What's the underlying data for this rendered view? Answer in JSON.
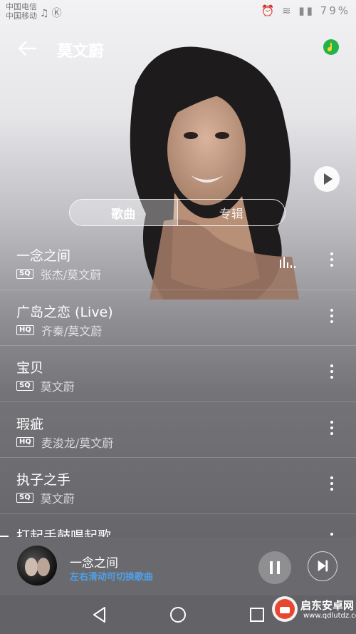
{
  "status_bar": {
    "carrier_1": "中国电信",
    "carrier_2": "中国移动",
    "battery": "79%"
  },
  "header": {
    "title": "莫文蔚"
  },
  "tabs": [
    {
      "label": "歌曲",
      "active": true
    },
    {
      "label": "专辑",
      "active": false
    }
  ],
  "songs": [
    {
      "title": "一念之间",
      "quality": "SQ",
      "artist": "张杰/莫文蔚",
      "playing": true
    },
    {
      "title": "广岛之恋 (Live)",
      "quality": "HQ",
      "artist": "齐秦/莫文蔚",
      "playing": false
    },
    {
      "title": "宝贝",
      "quality": "SQ",
      "artist": "莫文蔚",
      "playing": false
    },
    {
      "title": "瑕疵",
      "quality": "HQ",
      "artist": "麦浚龙/莫文蔚",
      "playing": false
    },
    {
      "title": "执子之手",
      "quality": "SQ",
      "artist": "莫文蔚",
      "playing": false
    },
    {
      "title": "打起手鼓唱起歌",
      "quality": "",
      "artist": "",
      "playing": false
    }
  ],
  "now_playing": {
    "title": "一念之间",
    "hint": "左右滑动可切换歌曲"
  },
  "watermark": {
    "name": "启东安卓网",
    "url": "www.qdlutdz.com"
  },
  "colors": {
    "accent_blue": "#4fa0e8",
    "app_green": "#24b34b"
  }
}
